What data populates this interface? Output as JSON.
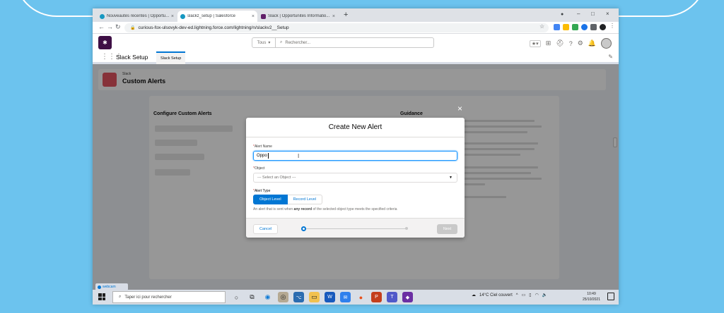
{
  "browser": {
    "tabs": [
      {
        "label": "Nouveautés récentes | Opportu...",
        "close": "×"
      },
      {
        "label": "slackz_setup | Salesforce",
        "close": "×"
      },
      {
        "label": "Slack | Opportunités Informatio...",
        "close": "×"
      }
    ],
    "new_tab": "+",
    "window_controls": {
      "minimize": "–",
      "maximize": "□",
      "close": "×"
    },
    "nav": {
      "back": "←",
      "forward": "→",
      "reload": "↻"
    },
    "url": "curious-fox-ulsovyk-dev-ed.lightning.force.com/lightning/n/slackv2__Setup"
  },
  "sf_header": {
    "search_scope": "Tous",
    "search_placeholder": "Rechercher..."
  },
  "nav": {
    "app_name": "Slack Setup",
    "tab_label": "Slack Setup"
  },
  "page": {
    "eyebrow": "Slack",
    "title": "Custom Alerts",
    "config_title": "Configure Custom Alerts",
    "guidance_title": "Guidance"
  },
  "modal": {
    "close": "×",
    "title": "Create New Alert",
    "alert_name_label": "Alert Name",
    "alert_name_value": "Oppo",
    "object_label": "Object",
    "object_value": "--- Select an Object ---",
    "alert_type_label": "Alert Type",
    "object_level": "Object Level",
    "record_level": "Record Level",
    "help_prefix": "An alert that is sent when",
    "help_bold": "any record",
    "help_suffix": "of the selected object type meets the specified criteria",
    "cancel": "Cancel",
    "next": "Next"
  },
  "taskbar": {
    "search_placeholder": "Taper ici pour rechercher",
    "weather": "14°C Ciel couvert",
    "time": "10:49",
    "date": "25/10/2021",
    "webcam": "webcam"
  }
}
